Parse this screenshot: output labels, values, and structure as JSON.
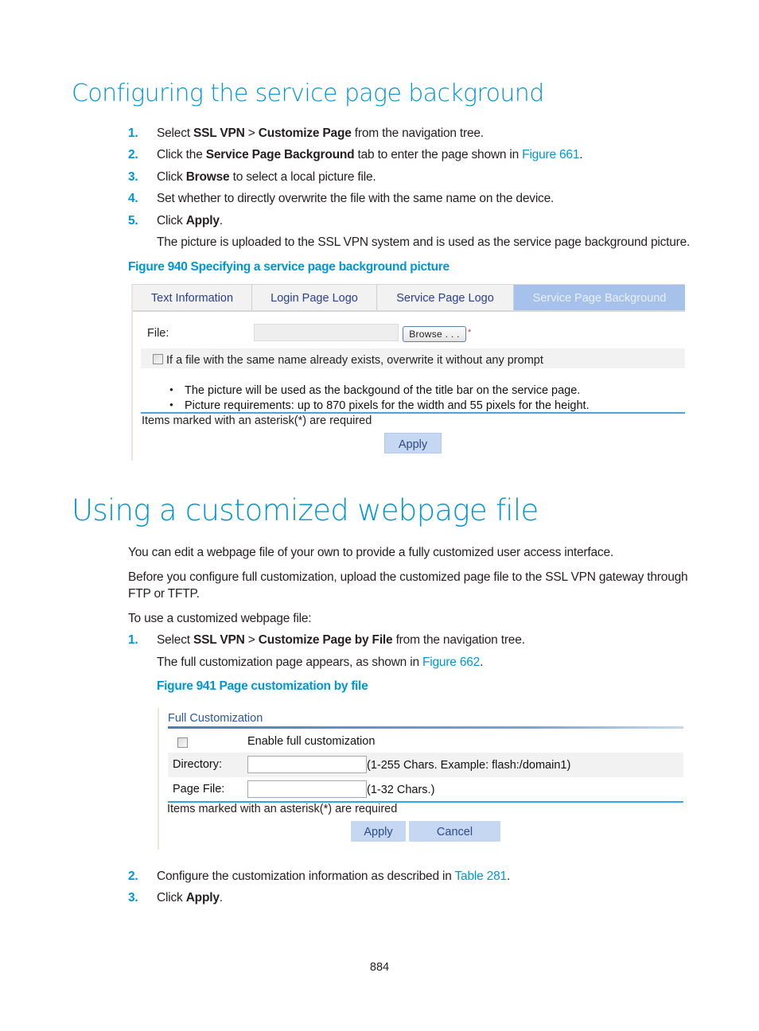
{
  "section1": {
    "heading": "Configuring the service page background",
    "steps": [
      {
        "num": "1.",
        "parts": [
          "Select ",
          "SSL VPN",
          " > ",
          "Customize Page",
          " from the navigation tree."
        ]
      },
      {
        "num": "2.",
        "parts": [
          "Click the ",
          "Service Page Background",
          " tab to enter the page shown in ",
          "Figure 661",
          "."
        ]
      },
      {
        "num": "3.",
        "parts": [
          "Click ",
          "Browse",
          " to select a local picture file."
        ]
      },
      {
        "num": "4.",
        "text": "Set whether to directly overwrite the file with the same name on the device."
      },
      {
        "num": "5.",
        "parts": [
          "Click ",
          "Apply",
          "."
        ]
      }
    ],
    "step5_note": "The picture is uploaded to the SSL VPN system and is used as the service page background picture.",
    "figure_caption": "Figure 940 Specifying a service page background picture"
  },
  "figure940": {
    "tabs": [
      {
        "label": "Text Information",
        "active": false
      },
      {
        "label": "Login Page Logo",
        "active": false
      },
      {
        "label": "Service Page Logo",
        "active": false
      },
      {
        "label": "Service Page Background",
        "active": true
      }
    ],
    "file_label": "File:",
    "file_value": "",
    "browse_label": "Browse . . .",
    "required_mark": "*",
    "overwrite_label": "If a file with the same name already exists, overwrite it without any prompt",
    "overwrite_checked": false,
    "notes": [
      "The picture will be used as the backgound of the title bar on the service page.",
      "Picture requirements: up to 870 pixels for the width and 55 pixels for the height."
    ],
    "required_note": "Items marked with an asterisk(*) are required",
    "apply_label": "Apply"
  },
  "section2": {
    "heading": "Using a customized webpage file",
    "para1": "You can edit a webpage file of your own to provide a fully customized user access interface.",
    "para2_line1": "Before you configure full customization, upload the customized page file to the SSL VPN gateway through",
    "para2_line2": "FTP or TFTP.",
    "intro": "To use a customized webpage file:",
    "step1": {
      "num": "1.",
      "parts": [
        "Select ",
        "SSL VPN",
        " > ",
        "Customize Page by File",
        " from the navigation tree."
      ]
    },
    "step1_note_pre": "The full customization page appears, as shown in ",
    "step1_note_link": "Figure 662",
    "step1_note_post": ".",
    "figure_caption": "Figure 941 Page customization by file",
    "step2": {
      "num": "2.",
      "pre": "Configure the customization information as described in ",
      "link": "Table 281",
      "post": "."
    },
    "step3": {
      "num": "3.",
      "pre": "Click ",
      "bold": "Apply",
      "post": "."
    }
  },
  "figure941": {
    "title": "Full Customization",
    "enable_label": "Enable full customization",
    "enable_checked": false,
    "directory_label": "Directory:",
    "directory_value": "",
    "directory_hint": "(1-255 Chars. Example: flash:/domain1)",
    "pagefile_label": "Page File:",
    "pagefile_value": "",
    "pagefile_hint": "(1-32 Chars.)",
    "required_note": "Items marked with an asterisk(*) are required",
    "apply_label": "Apply",
    "cancel_label": "Cancel"
  },
  "page_number": "884"
}
